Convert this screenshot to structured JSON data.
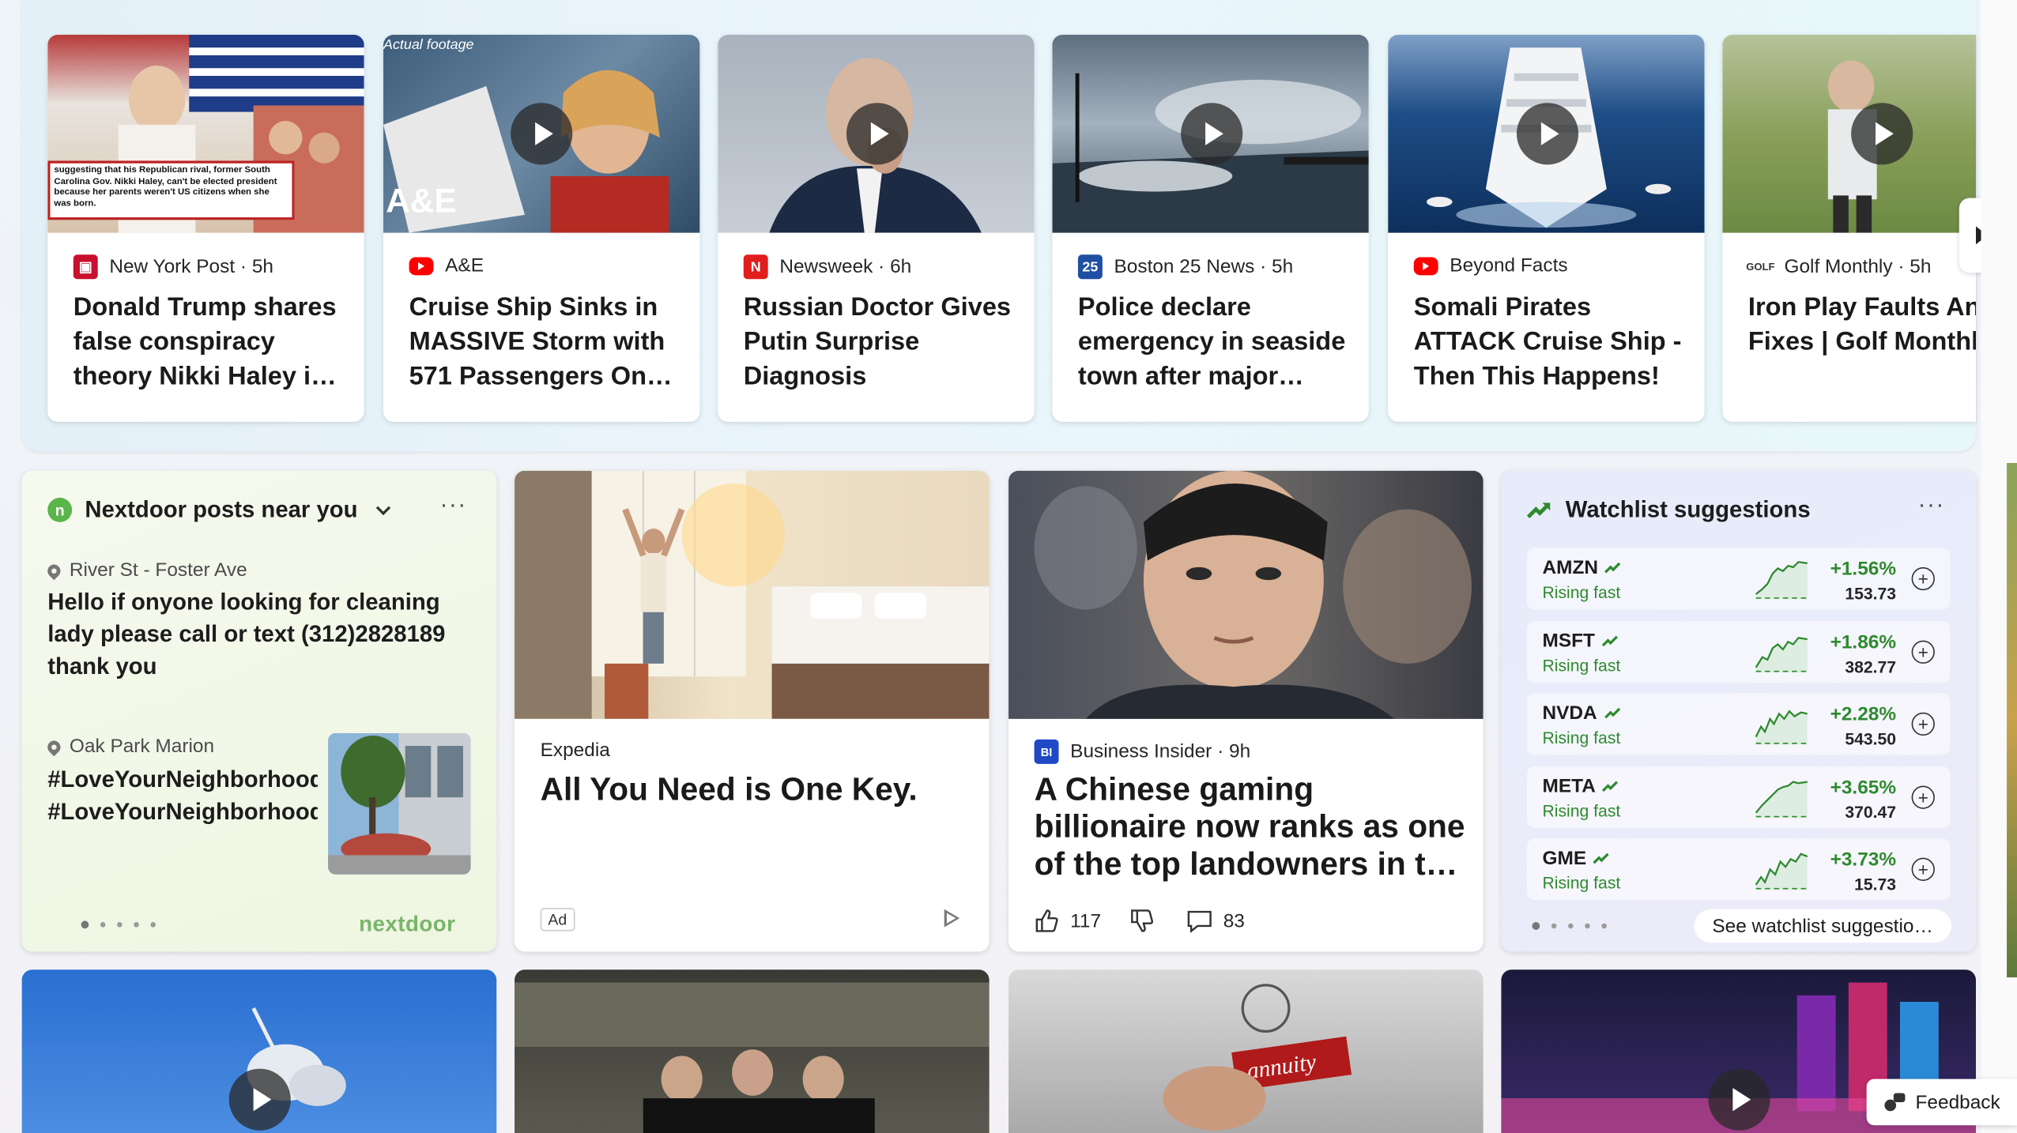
{
  "video_carousel": [
    {
      "source": "New York Post",
      "age": "5h",
      "title": "Donald Trump shares false conspiracy theory Nikki Haley i…",
      "icon": "newyorkpost-icon",
      "icon_color": "#c8102e",
      "caption": "suggesting that his Republican rival, former South Carolina Gov. Nikki Haley, can't be elected president because her parents weren't US citizens when she was born.",
      "has_play": false
    },
    {
      "source": "A&E",
      "age": "",
      "title": "Cruise Ship Sinks in MASSIVE Storm with 571 Passengers On…",
      "icon": "youtube-icon",
      "icon_color": "#ff0000",
      "overlay_text": "Actual footage",
      "brand_mark": "A&E",
      "has_play": true
    },
    {
      "source": "Newsweek",
      "age": "6h",
      "title": "Russian Doctor Gives Putin Surprise Diagnosis",
      "icon": "newsweek-icon",
      "icon_color": "#e21d1d",
      "icon_letter": "N",
      "has_play": true
    },
    {
      "source": "Boston 25 News",
      "age": "5h",
      "title": "Police declare emergency in seaside town after major…",
      "icon": "boston25-icon",
      "icon_color": "#1f4fa3",
      "icon_letter": "25",
      "has_play": true
    },
    {
      "source": "Beyond Facts",
      "age": "",
      "title": "Somali Pirates ATTACK Cruise Ship - Then This Happens!",
      "icon": "youtube-icon",
      "icon_color": "#ff0000",
      "has_play": true
    },
    {
      "source": "Golf Monthly",
      "age": "5h",
      "title": "Iron Play Faults And Fixes | Golf Monthly",
      "icon": "golfmonthly-icon",
      "icon_color": "#333333",
      "icon_letter": "GOLF",
      "has_play": true
    }
  ],
  "nextdoor": {
    "title": "Nextdoor posts near you",
    "posts": [
      {
        "location": "River St - Foster Ave",
        "text_lines": [
          "Hello if onyone looking for cleaning",
          "lady please call or text (312)2828189",
          "thank you"
        ]
      },
      {
        "location": "Oak Park Marion",
        "text_lines": [
          "#LoveYourNeighborhood(",
          "#LoveYourNeighborhood("
        ]
      }
    ],
    "brand": "nextdoor",
    "accent": "#5ab54a"
  },
  "ad": {
    "source": "Expedia",
    "title": "All You Need is One Key.",
    "badge": "Ad"
  },
  "business_insider": {
    "source": "Business Insider",
    "age": "9h",
    "icon_letter": "BI",
    "title": "A Chinese gaming billionaire now ranks as one of the top landowners in t…",
    "likes": "117",
    "comments": "83"
  },
  "watchlist": {
    "title": "Watchlist suggestions",
    "rows": [
      {
        "symbol": "AMZN",
        "status": "Rising fast",
        "change": "+1.56%",
        "price": "153.73"
      },
      {
        "symbol": "MSFT",
        "status": "Rising fast",
        "change": "+1.86%",
        "price": "382.77"
      },
      {
        "symbol": "NVDA",
        "status": "Rising fast",
        "change": "+2.28%",
        "price": "543.50"
      },
      {
        "symbol": "META",
        "status": "Rising fast",
        "change": "+3.65%",
        "price": "370.47"
      },
      {
        "symbol": "GME",
        "status": "Rising fast",
        "change": "+3.73%",
        "price": "15.73"
      }
    ],
    "see_button": "See watchlist suggestio…",
    "positive_color": "#2e8a2f"
  },
  "feedback": {
    "label": "Feedback"
  }
}
